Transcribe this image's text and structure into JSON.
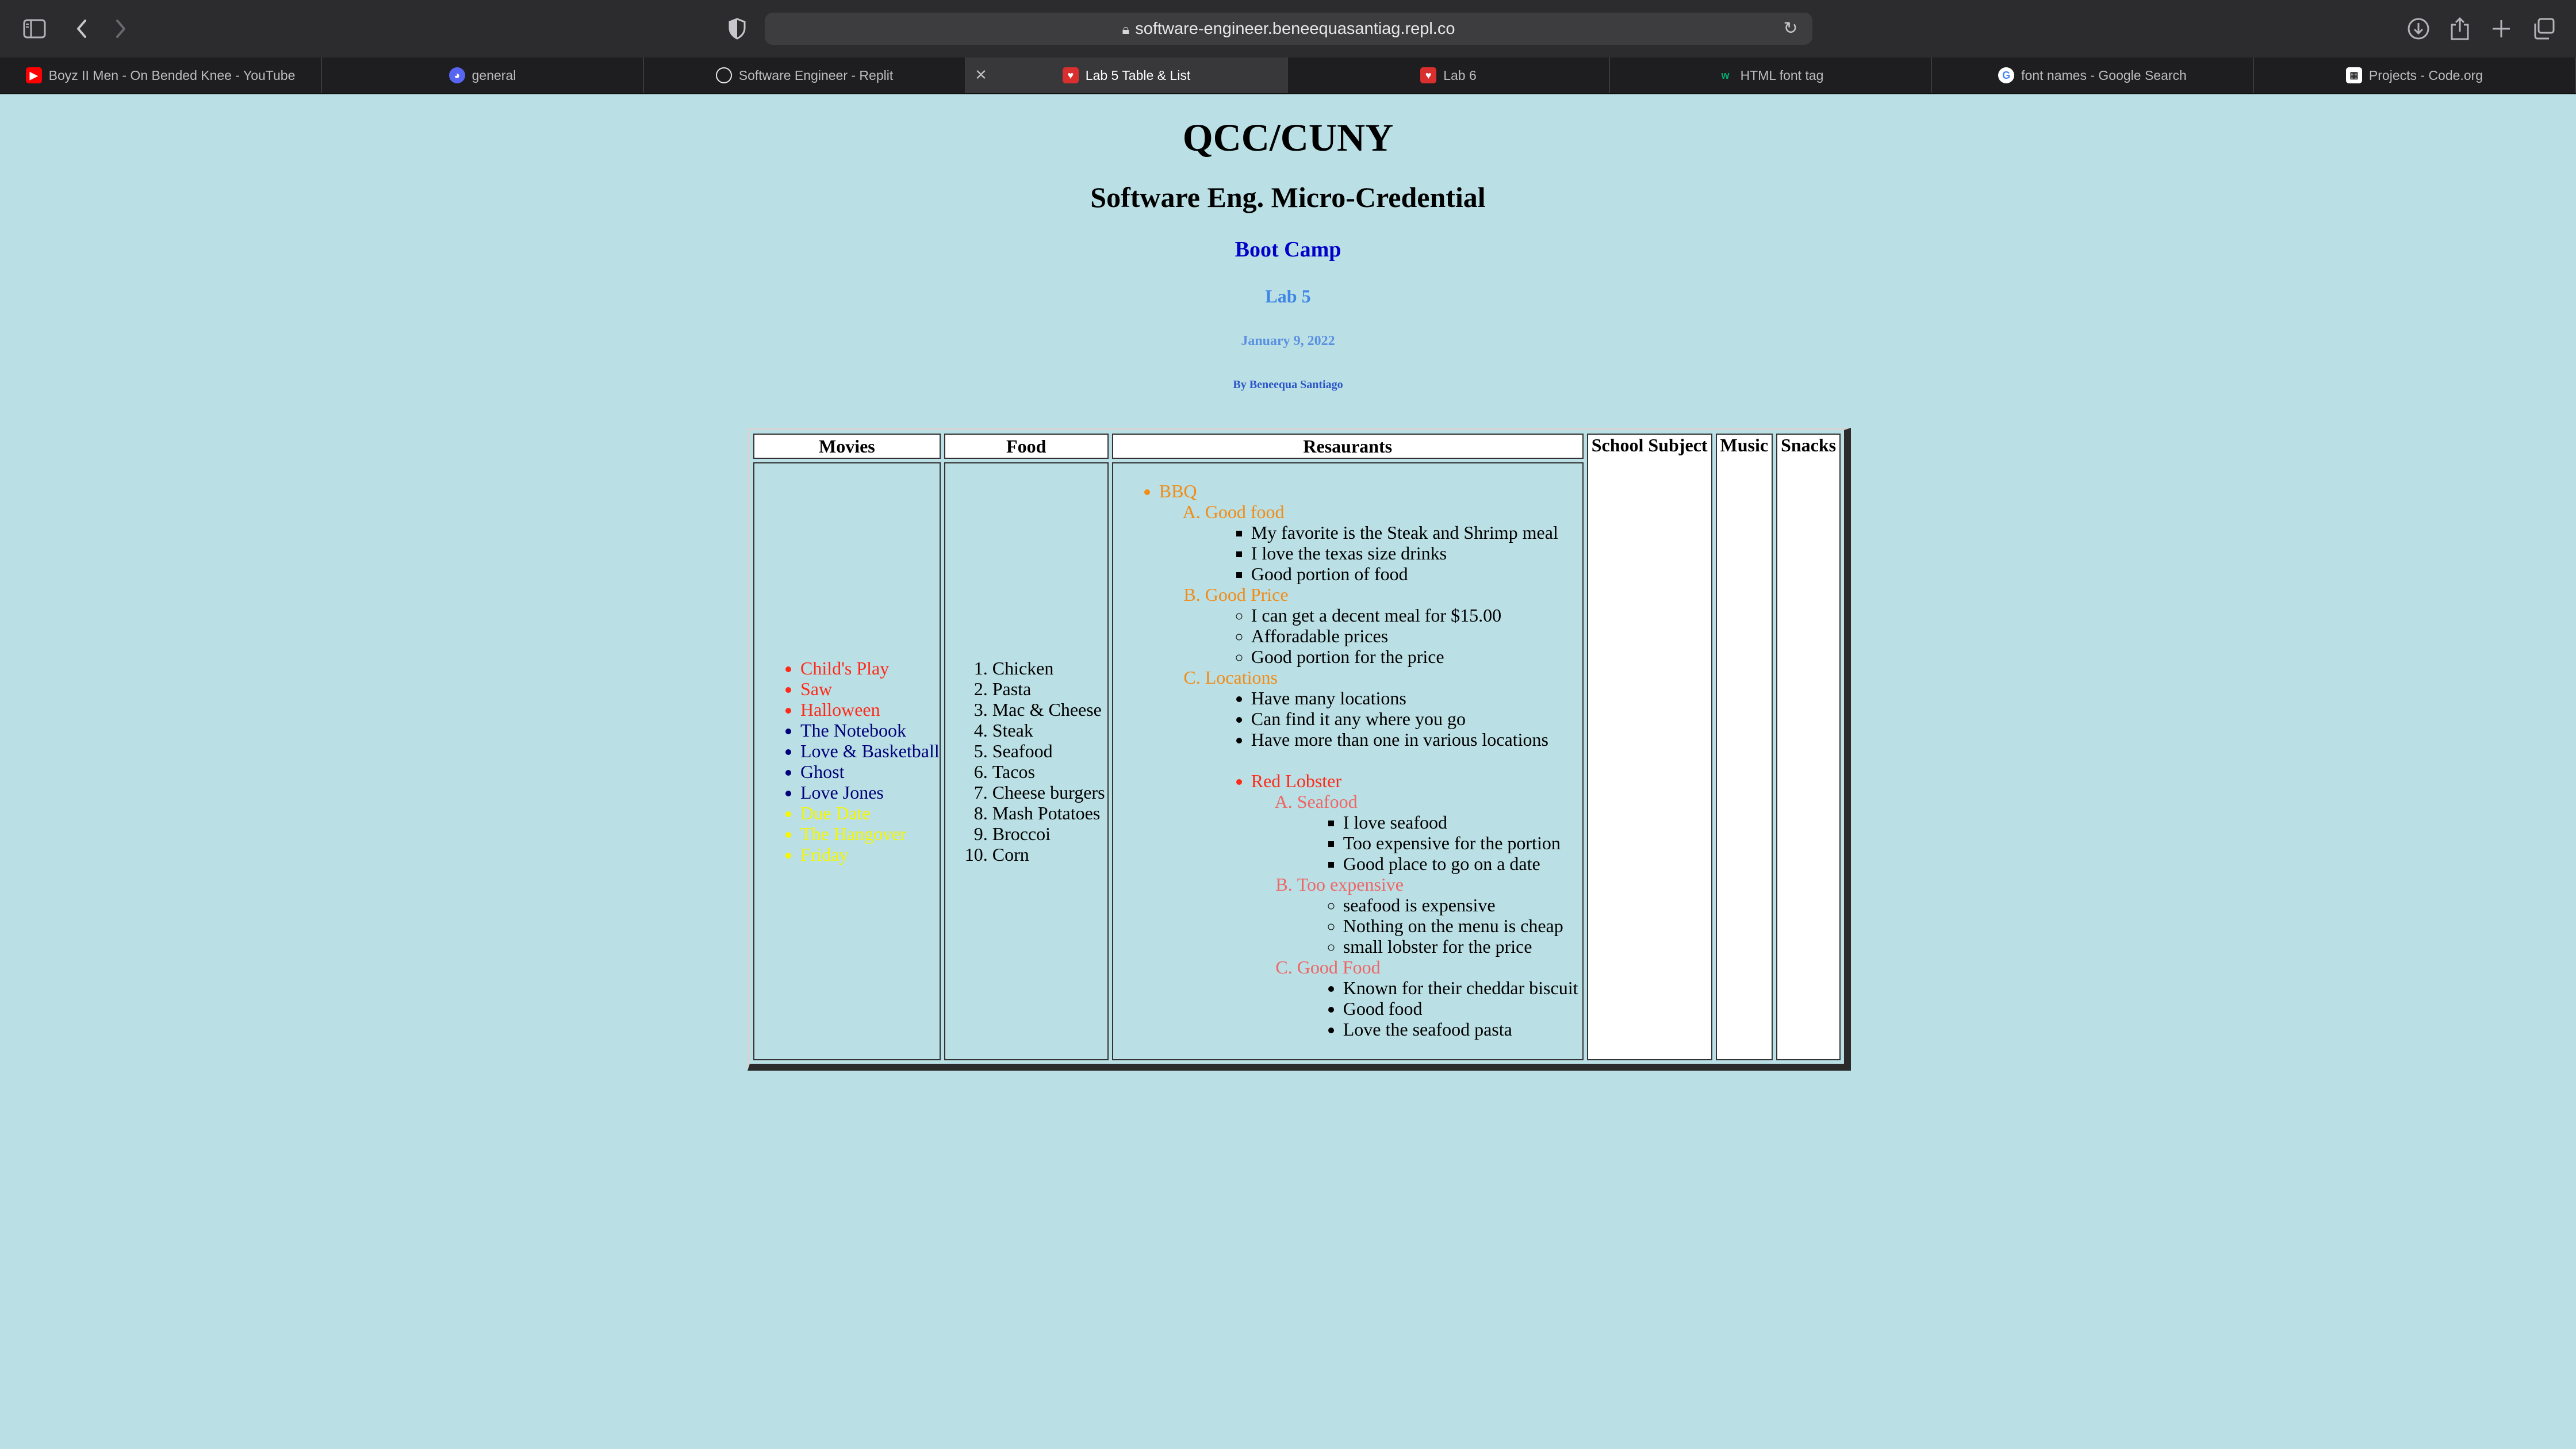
{
  "browser": {
    "url": "software-engineer.beneequasantiag.repl.co",
    "tabs": [
      {
        "label": "Boyz II Men - On Bended Knee - YouTube",
        "icon": "youtube-icon",
        "color": "#ff0000"
      },
      {
        "label": "general",
        "icon": "discord-icon",
        "color": "#5865f2"
      },
      {
        "label": "Software Engineer - Replit",
        "icon": "replit-icon",
        "color": "#e8e8e8"
      },
      {
        "label": "Lab 5 Table & List",
        "icon": "page-icon",
        "color": "#d9302f",
        "active": true
      },
      {
        "label": "Lab 6",
        "icon": "page-icon",
        "color": "#d9302f"
      },
      {
        "label": "HTML font tag",
        "icon": "w3-icon",
        "color": "#04aa6d"
      },
      {
        "label": "font names - Google Search",
        "icon": "google-icon",
        "color": "#4285f4"
      },
      {
        "label": "Projects - Code.org",
        "icon": "codeorg-icon",
        "color": "#ffffff"
      }
    ]
  },
  "page": {
    "title": "QCC/CUNY",
    "subtitle": "Software Eng. Micro-Credential",
    "boot_camp": "Boot Camp",
    "lab": "Lab 5",
    "date": "January 9, 2022",
    "author": "By Beneequa Santiago"
  },
  "table": {
    "headers": [
      "Movies",
      "Food",
      "Resaurants",
      "School Subject",
      "Music",
      "Snacks"
    ],
    "movies": [
      {
        "label": "Child's Play",
        "color": "red"
      },
      {
        "label": "Saw",
        "color": "red"
      },
      {
        "label": "Halloween",
        "color": "red"
      },
      {
        "label": "The Notebook",
        "color": "navy"
      },
      {
        "label": "Love & Basketball",
        "color": "navy"
      },
      {
        "label": "Ghost",
        "color": "navy"
      },
      {
        "label": "Love Jones",
        "color": "navy"
      },
      {
        "label": "Due Date",
        "color": "yellow"
      },
      {
        "label": "The Hangover",
        "color": "yellow"
      },
      {
        "label": "Friday",
        "color": "yellow"
      }
    ],
    "food": [
      "Chicken",
      "Pasta",
      "Mac & Cheese",
      "Steak",
      "Seafood",
      "Tacos",
      "Cheese burgers",
      "Mash Potatoes",
      "Broccoi",
      "Corn"
    ],
    "restaurants": {
      "bbq": {
        "name": "BBQ",
        "sections": [
          {
            "title": "Good food",
            "items": [
              "My favorite is the Steak and Shrimp meal",
              "I love the texas size drinks",
              "Good portion of food"
            ]
          },
          {
            "title": "Good Price",
            "items": [
              "I can get a decent meal for $15.00",
              "Afforadable prices",
              "Good portion for the price"
            ]
          },
          {
            "title": "Locations",
            "items": [
              "Have many locations",
              "Can find it any where you go",
              "Have more than one in various locations"
            ]
          }
        ]
      },
      "red_lobster": {
        "name": "Red Lobster",
        "sections": [
          {
            "title": "Seafood",
            "items": [
              "I love seafood",
              "Too expensive for the portion",
              "Good place to go on a date"
            ]
          },
          {
            "title": "Too expensive",
            "items": [
              "seafood is expensive",
              "Nothing on the menu is cheap",
              "small lobster for the price"
            ]
          },
          {
            "title": "Good Food",
            "items": [
              "Known for their cheddar biscuit",
              "Good food",
              "Love the seafood pasta"
            ]
          }
        ]
      }
    }
  }
}
